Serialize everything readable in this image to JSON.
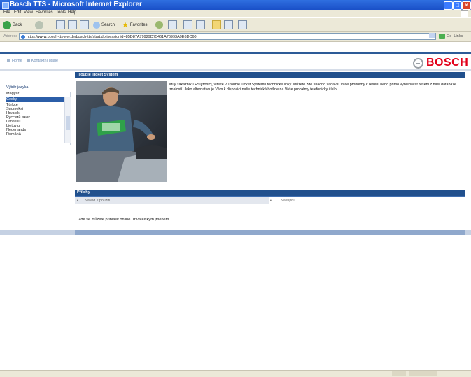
{
  "window": {
    "title": "Bosch TTS - Microsoft Internet Explorer",
    "minimize": "_",
    "maximize": "□",
    "close": "✕"
  },
  "menu": [
    "File",
    "Edit",
    "View",
    "Favorites",
    "Tools",
    "Help"
  ],
  "toolbar": {
    "back": "Back",
    "search": "Search",
    "favorites": "Favorites"
  },
  "address": {
    "label": "Address",
    "url": "https://www.bosch-tts-ww.de/bosch-tts/start.do;jsessionid=85D87A79929D75461A76993A9E6DC60",
    "go": "Go",
    "links": "Links"
  },
  "header": {
    "nav_home": "Home",
    "nav_contact": "Kontaktní údaje",
    "logo_word": "BOSCH"
  },
  "sidebar": {
    "title": "Výběr jazyka",
    "items": [
      "Magyar",
      "Česky",
      "Türkçe",
      "Suomeksi",
      "Hrvatski",
      "Русский язык",
      "Latviešu",
      "Lietuvių",
      "Nederlands",
      "Română"
    ],
    "selected_index": 1
  },
  "main": {
    "header": "Trouble Ticket System",
    "body": "Milý zákazníku ESI[tronic], vítejte v Trouble Ticket Systému technické linky. Můžete zde snadno zadávat Vaše problémy k řešení nebo přímo vyhledávat řešení z naší databáze znalostí. Jako alternativu je Vám k dispozici naše technická hotline na Vaše problémy telefonicky číslo.",
    "attachments_header": "Přílohy",
    "attachment_col1": "Návod k použití",
    "attachment_col2": "Nákupní",
    "footnote": "Zde se můžete přihlásit online uživatelským jménem"
  }
}
